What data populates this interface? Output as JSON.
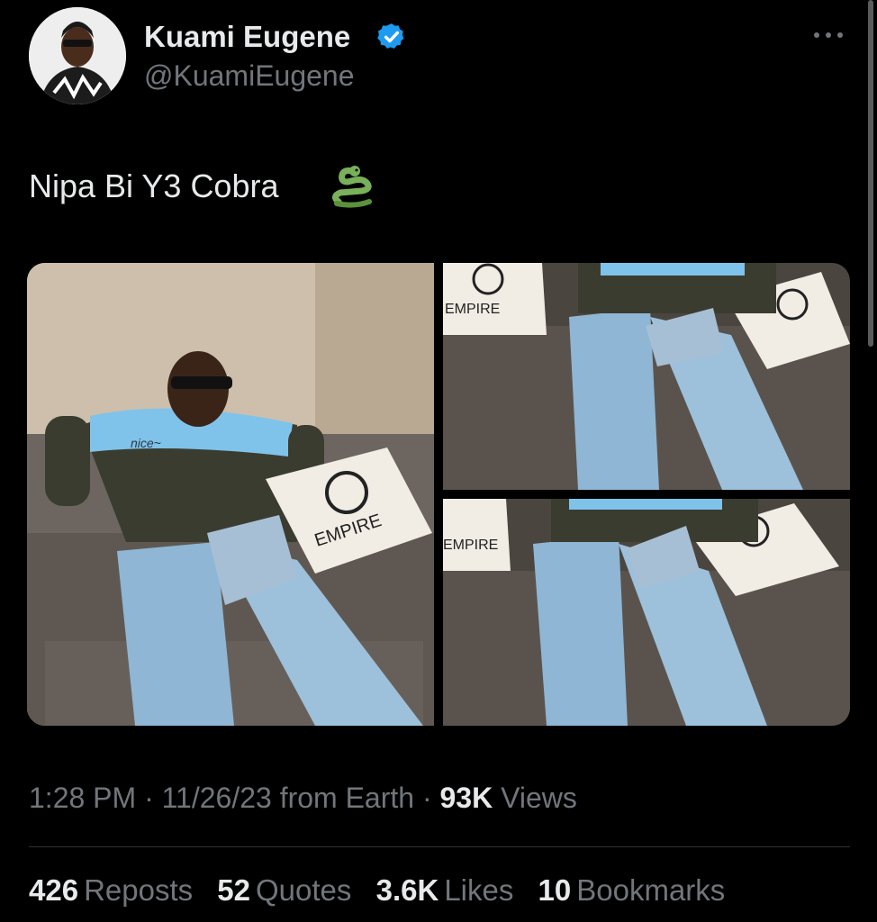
{
  "author": {
    "name": "Kuami Eugene",
    "handle": "@KuamiEugene",
    "verified_color": "#1d9bf0"
  },
  "tweet": {
    "text": "Nipa Bi Y3 Cobra",
    "emoji_icon": "snake-icon"
  },
  "media": {
    "pillow_brand": "EMPIRE",
    "sweater_text": "nice~"
  },
  "meta": {
    "time": "1:28 PM",
    "date": "11/26/23",
    "source": "from Earth",
    "views_count": "93K",
    "views_label": "Views"
  },
  "stats": [
    {
      "count": "426",
      "label": "Reposts"
    },
    {
      "count": "52",
      "label": "Quotes"
    },
    {
      "count": "3.6K",
      "label": "Likes"
    },
    {
      "count": "10",
      "label": "Bookmarks"
    }
  ],
  "colors": {
    "background": "#000000",
    "text_primary": "#e7e9ea",
    "text_secondary": "#71767b",
    "verified": "#1d9bf0",
    "divider": "#2f3336"
  }
}
